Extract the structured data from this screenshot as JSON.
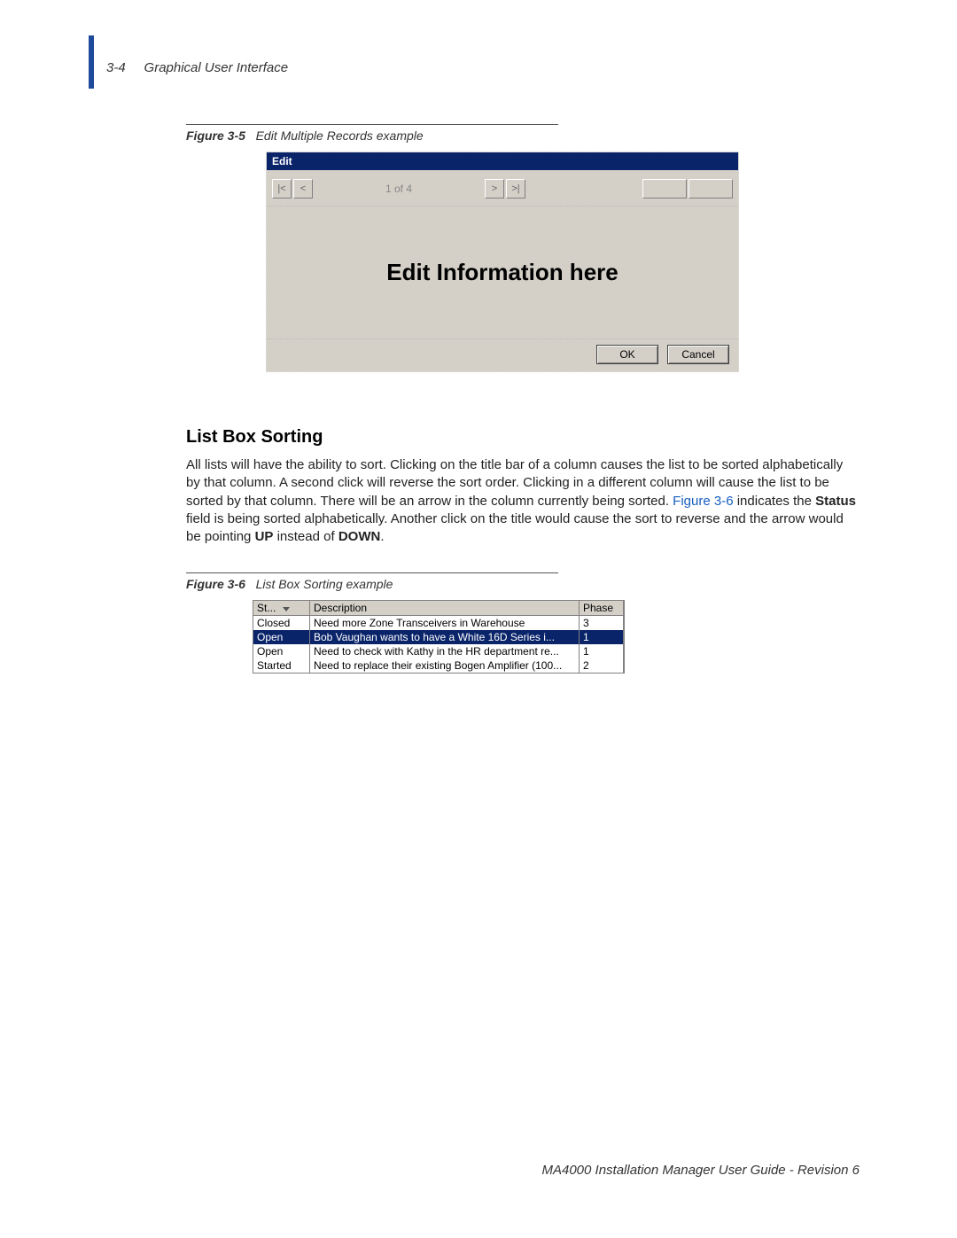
{
  "header": {
    "page_num": "3-4",
    "title": "Graphical User Interface"
  },
  "figure5": {
    "label": "Figure 3-5",
    "caption": "Edit Multiple Records example"
  },
  "edit_dialog": {
    "title": "Edit",
    "nav_first": "|<",
    "nav_prev": "<",
    "counter": "1 of 4",
    "nav_next": ">",
    "nav_last": ">|",
    "body_text": "Edit Information here",
    "ok": "OK",
    "cancel": "Cancel"
  },
  "section": {
    "heading": "List Box Sorting",
    "para_1": "All lists will have the ability to sort. Clicking on the title bar of a column causes the list to be sorted alphabetically by that column. A second click will reverse the sort order. Clicking in a different column will cause the list to be sorted by that column. There will be an arrow in the column currently being sorted. ",
    "link_text": "Figure 3-6",
    "para_2a": " indicates the ",
    "status_word": "Status",
    "para_2b": " field is being sorted alphabetically. Another click on the title would cause the sort to reverse and the arrow would be pointing ",
    "up_word": "UP",
    "para_2c": " instead of ",
    "down_word": "DOWN",
    "para_2d": "."
  },
  "figure6": {
    "label": "Figure 3-6",
    "caption": "List Box Sorting example"
  },
  "listbox": {
    "headers": {
      "status": "St...",
      "description": "Description",
      "phase": "Phase"
    },
    "rows": [
      {
        "status": "Closed",
        "description": "Need more Zone Transceivers in Warehouse",
        "phase": "3",
        "selected": false
      },
      {
        "status": "Open",
        "description": "Bob Vaughan wants to have a White 16D Series i...",
        "phase": "1",
        "selected": true
      },
      {
        "status": "Open",
        "description": "Need to check with Kathy in the HR department re...",
        "phase": "1",
        "selected": false
      },
      {
        "status": "Started",
        "description": "Need to replace their existing Bogen Amplifier (100...",
        "phase": "2",
        "selected": false
      }
    ]
  },
  "footer": {
    "text": "MA4000 Installation Manager User Guide - Revision 6"
  }
}
